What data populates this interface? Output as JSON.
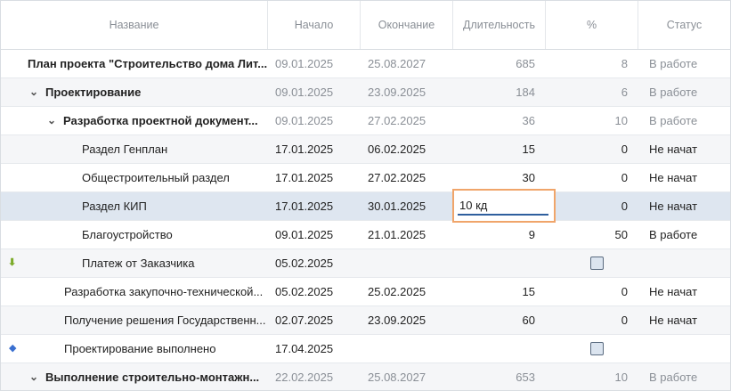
{
  "columns": {
    "name": "Название",
    "start": "Начало",
    "end": "Окончание",
    "duration": "Длительность",
    "percent": "%",
    "status": "Статус"
  },
  "rows": [
    {
      "name": "План проекта \"Строительство дома Лит...",
      "start": "09.01.2025",
      "end": "25.08.2027",
      "duration": "685",
      "percent": "8",
      "status": "В работе"
    },
    {
      "name": "Проектирование",
      "start": "09.01.2025",
      "end": "23.09.2025",
      "duration": "184",
      "percent": "6",
      "status": "В работе"
    },
    {
      "name": "Разработка проектной документ...",
      "start": "09.01.2025",
      "end": "27.02.2025",
      "duration": "36",
      "percent": "10",
      "status": "В работе"
    },
    {
      "name": "Раздел Генплан",
      "start": "17.01.2025",
      "end": "06.02.2025",
      "duration": "15",
      "percent": "0",
      "status": "Не начат"
    },
    {
      "name": "Общестроительный раздел",
      "start": "17.01.2025",
      "end": "27.02.2025",
      "duration": "30",
      "percent": "0",
      "status": "Не начат"
    },
    {
      "name": "Раздел КИП",
      "start": "17.01.2025",
      "end": "30.01.2025",
      "duration": "10 кд",
      "percent": "0",
      "status": "Не начат"
    },
    {
      "name": "Благоустройство",
      "start": "09.01.2025",
      "end": "21.01.2025",
      "duration": "9",
      "percent": "50",
      "status": "В работе"
    },
    {
      "name": "Платеж от Заказчика",
      "start": "05.02.2025",
      "end": "",
      "duration": "",
      "percent": "",
      "status": ""
    },
    {
      "name": "Разработка закупочно-технической...",
      "start": "05.02.2025",
      "end": "25.02.2025",
      "duration": "15",
      "percent": "0",
      "status": "Не начат"
    },
    {
      "name": "Получение решения Государственн...",
      "start": "02.07.2025",
      "end": "23.09.2025",
      "duration": "60",
      "percent": "0",
      "status": "Не начат"
    },
    {
      "name": "Проектирование выполнено",
      "start": "17.04.2025",
      "end": "",
      "duration": "",
      "percent": "",
      "status": ""
    },
    {
      "name": "Выполнение строительно-монтажн...",
      "start": "22.02.2025",
      "end": "25.08.2027",
      "duration": "653",
      "percent": "10",
      "status": "В работе"
    }
  ],
  "icons": {
    "expand": "chevron-down-icon",
    "payment": "arrow-down-icon",
    "milestone": "diamond-icon"
  },
  "colors": {
    "editor_border": "#f0a56a",
    "selected_row": "#dee6f0",
    "payment_icon": "#7cab2a",
    "milestone_icon": "#3a6fd0"
  }
}
